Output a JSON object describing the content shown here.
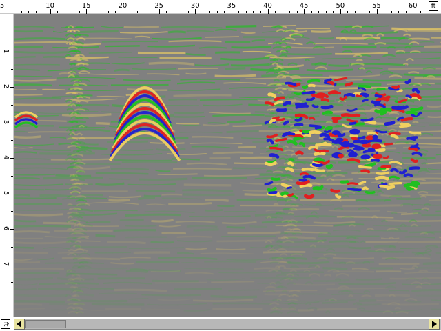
{
  "horizontal_axis": {
    "unit": "ft",
    "ticks": [
      "5",
      "10",
      "15",
      "20",
      "25",
      "30",
      "35",
      "40",
      "45",
      "50",
      "55",
      "60"
    ]
  },
  "vertical_axis": {
    "unit": "ft",
    "ticks": [
      "1",
      "2",
      "3",
      "4",
      "5",
      "6",
      "7"
    ]
  },
  "scrollbar": {
    "position_fraction": 0.0,
    "visible_fraction": 0.1
  },
  "colors": {
    "background": "#808080",
    "positive_low": "#f0d060",
    "positive_high": "#e02020",
    "negative_low": "#20c020",
    "negative_high": "#2020d0",
    "scroll_button": "#e8e3a0"
  }
}
